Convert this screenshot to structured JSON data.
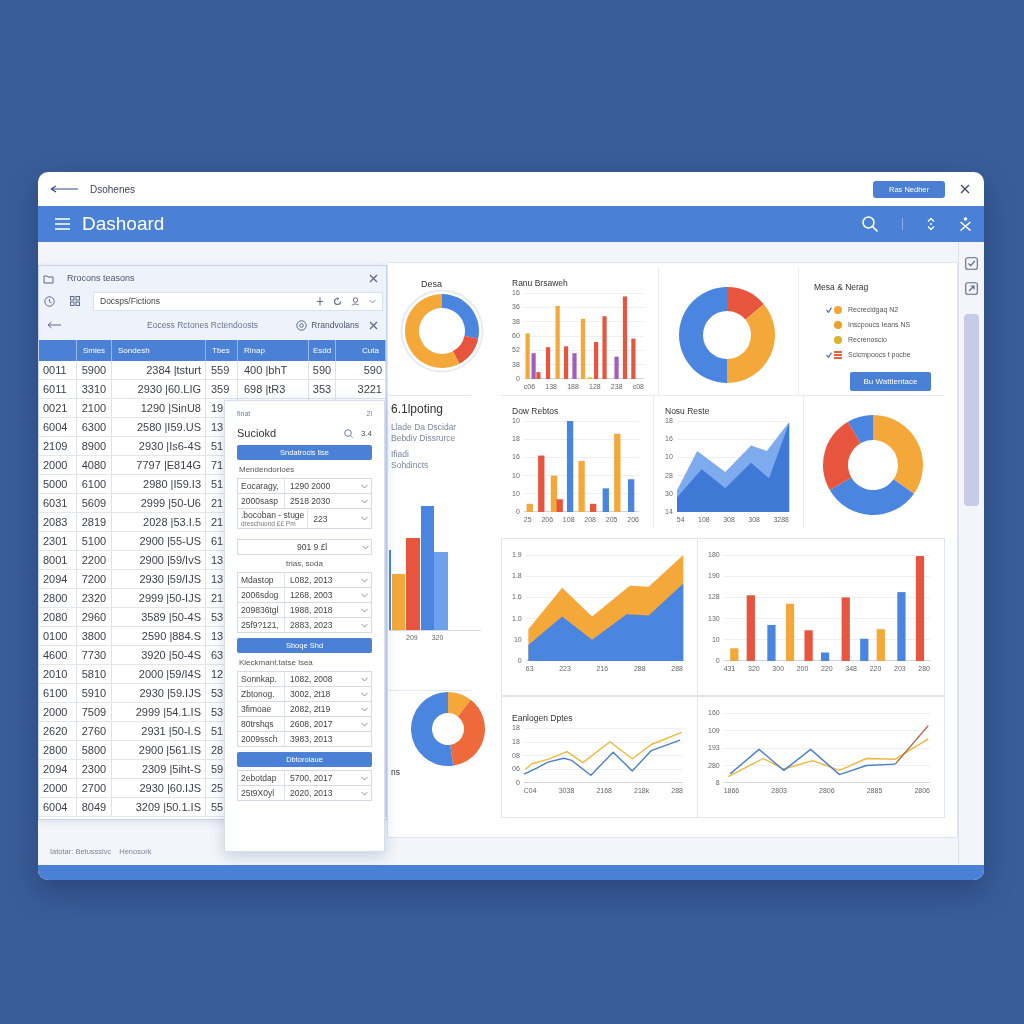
{
  "window": {
    "title": "Dsohenes",
    "button": "Ras Nedher"
  },
  "header": {
    "title": "Dashoard"
  },
  "records_panel": {
    "title": "Rrocons teasons",
    "search": {
      "value": "Docsps/Fictions"
    },
    "nav": {
      "text": "Eocess Rctones Rctendoosts",
      "link": "Rrandvolans"
    },
    "table": {
      "columns": [
        "",
        "Smies",
        "Sondesh",
        "Tbes",
        "Rinap",
        "Esdd",
        "Cuta"
      ],
      "rows": [
        [
          "0011",
          "5900",
          "2384 |tsturt",
          "559",
          "400 |bhT",
          "590",
          "590"
        ],
        [
          "6011",
          "3310",
          "2930 |60.LIG",
          "359",
          "698 |tR3",
          "353",
          "3221"
        ],
        [
          "0021",
          "2100",
          "1290 |SinU8",
          "19"
        ],
        [
          "6004",
          "6300",
          "2580 |I59.US",
          "13"
        ],
        [
          "2109",
          "8900",
          "2930 |Is6-4S",
          "51"
        ],
        [
          "2000",
          "4080",
          "7797 |E814G",
          "71"
        ],
        [
          "5000",
          "6100",
          "2980 |I59.I3",
          "51"
        ],
        [
          "6031",
          "5609",
          "2999 |50-U6",
          "21"
        ],
        [
          "2083",
          "2819",
          "2028 |53.I.5",
          "21"
        ],
        [
          "2301",
          "5100",
          "2900 |55-US",
          "61"
        ],
        [
          "8001",
          "2200",
          "2900 |59/IvS",
          "13"
        ],
        [
          "2094",
          "7200",
          "2930 |59/IJS",
          "13"
        ],
        [
          "2800",
          "2320",
          "2999 |50-IJS",
          "21"
        ],
        [
          "2080",
          "2960",
          "3589 |50-4S",
          "53"
        ],
        [
          "0100",
          "3800",
          "2590 |884.S",
          "13"
        ],
        [
          "4600",
          "7730",
          "3920 |50-4S",
          "63"
        ],
        [
          "2010",
          "5810",
          "2000 |59/I4S",
          "12"
        ],
        [
          "6100",
          "5910",
          "2930 |59.IJS",
          "53"
        ],
        [
          "2000",
          "7509",
          "2999 |54.1.IS",
          "53"
        ],
        [
          "2620",
          "2760",
          "2931 |50-I.S",
          "51"
        ],
        [
          "2800",
          "5800",
          "2900 |561.IS",
          "28"
        ],
        [
          "2094",
          "2300",
          "2309 |5iht-S",
          "59"
        ],
        [
          "2000",
          "2700",
          "2930 |60.IJS",
          "25"
        ],
        [
          "6004",
          "8049",
          "3209 |50.1.IS",
          "55"
        ]
      ]
    }
  },
  "filter_panel": {
    "caption": "finat",
    "corner": "2l",
    "title": "Suciokd",
    "count": "3.4",
    "sections": [
      {
        "kind": "button",
        "label": "Sndatrocis lise"
      },
      {
        "kind": "heading",
        "text": "Mendendorloes"
      },
      {
        "kind": "fields",
        "rows": [
          {
            "label": "Eocaragy,",
            "value": "1290 2000",
            "chevron": true
          },
          {
            "label": "2000sasp",
            "value": "2518 2030",
            "chevron": true
          },
          {
            "label": ".bocoban - stuge",
            "note": "dreschuond ££ Pm",
            "value": "223",
            "chevron": true
          }
        ]
      },
      {
        "kind": "single",
        "value": "901 9 £l",
        "chevron": true
      },
      {
        "kind": "caption",
        "text": "trias, soda"
      },
      {
        "kind": "fields",
        "rows": [
          {
            "label": "Mdastop",
            "value": "L082, 2013",
            "chevron": true
          },
          {
            "label": "2006sdog",
            "value": "1268, 2003",
            "chevron": true
          },
          {
            "label": "209836tgl",
            "value": "1988, 2018",
            "chevron": true
          },
          {
            "label": "25f9?121,",
            "value": "2883, 2023",
            "chevron": true
          }
        ]
      },
      {
        "kind": "button",
        "label": "Sboqe Shd"
      },
      {
        "kind": "heading",
        "text": "Kieckmant.tatse lsea"
      },
      {
        "kind": "fields",
        "rows": [
          {
            "label": "Sonnkap.",
            "value": "1082, 2008",
            "chevron": true
          },
          {
            "label": "Zbtonog.",
            "value": "3002, 2t18",
            "chevron": true
          },
          {
            "label": "3fimoae",
            "value": "2082, 2t19",
            "chevron": true
          },
          {
            "label": "80trshqs",
            "value": "2608, 2017",
            "chevron": true
          },
          {
            "label": "2009ssch",
            "value": "3983, 2013",
            "chevron": false
          }
        ]
      },
      {
        "kind": "button",
        "label": "Dbtoroiaue"
      },
      {
        "kind": "fields",
        "rows": [
          {
            "label": "2ebotdap",
            "value": "5700, 2017",
            "chevron": true
          },
          {
            "label": "25t9X0yl",
            "value": "2020, 2013",
            "chevron": true
          }
        ]
      }
    ]
  },
  "dashboard": {
    "side": {
      "donut_title": "Desa",
      "heading": "6.1lpoting",
      "lines": [
        "Llade Da Dscidar",
        "Bebdiv Dissrurce",
        "Ifiadi",
        "Sohdincts"
      ],
      "bar_x_labels": [
        "209",
        "320"
      ],
      "caption": "ns"
    },
    "rows": [
      {
        "cells": [
          {
            "kind": "bar",
            "title": "Ranu Brsaweh",
            "y_labels": [
              "16",
              "36",
              "38",
              "60",
              "52",
              "38",
              "0"
            ],
            "x_labels": [
              "c06",
              "138",
              "188",
              "128",
              "238",
              "c08"
            ]
          },
          {
            "kind": "donut"
          },
          {
            "kind": "legend",
            "title": "Mesa & Nerag",
            "items": [
              {
                "label": "Recrecidgaq N2",
                "color": "#f2a533",
                "kind": "dot",
                "marked": true
              },
              {
                "label": "Inscpoucs Ieans NS",
                "color": "#eea02c",
                "kind": "dot",
                "marked": false
              },
              {
                "label": "Recrenoscio",
                "color": "#d9b22e",
                "kind": "dot",
                "marked": false
              },
              {
                "label": "Scicmpoocs t pocbe",
                "color": "#e5603b",
                "kind": "stack",
                "marked": true
              }
            ],
            "button": "Bu Wattlentace"
          }
        ]
      },
      {
        "cells": [
          {
            "kind": "bar",
            "title": "Dow Rebtos",
            "y_labels": [
              "10",
              "18",
              "16",
              "10",
              "10",
              "0"
            ],
            "x_labels": [
              "25",
              "206",
              "108",
              "208",
              "205",
              "206"
            ]
          },
          {
            "kind": "area",
            "title": "Nosu Reste",
            "y_labels": [
              "18",
              "16",
              "10",
              "28",
              "30",
              "14"
            ],
            "x_labels": [
              "54",
              "108",
              "308",
              "308",
              "3288"
            ]
          },
          {
            "kind": "donut"
          }
        ]
      },
      {
        "cells": [
          {
            "kind": "stacked_area",
            "y_labels": [
              "1.9",
              "1.8",
              "1.6",
              "1.0",
              "10",
              "0"
            ],
            "x_labels": [
              "63",
              "223",
              "216",
              "288",
              "288"
            ]
          },
          {
            "kind": "bar",
            "y_labels": [
              "180",
              "190",
              "128",
              "130",
              "10",
              "0"
            ],
            "x_labels": [
              "431",
              "320",
              "300",
              "200",
              "220",
              "348",
              "220",
              "203",
              "280"
            ]
          }
        ]
      },
      {
        "cells": [
          {
            "kind": "line",
            "title": "Eanlogen Dptes",
            "y_labels": [
              "18",
              "18",
              "08",
              "06",
              "0"
            ],
            "x_labels": [
              "C04",
              "3038",
              "2168",
              "218k",
              "288"
            ]
          },
          {
            "kind": "line",
            "y_labels": [
              "160",
              "109",
              "193",
              "280",
              "8"
            ],
            "x_labels": [
              "1866",
              "2803",
              "2806",
              "2885",
              "2806"
            ]
          }
        ]
      }
    ]
  },
  "footer": [
    "Iatotar: Betussslvc",
    "Henosork"
  ]
}
